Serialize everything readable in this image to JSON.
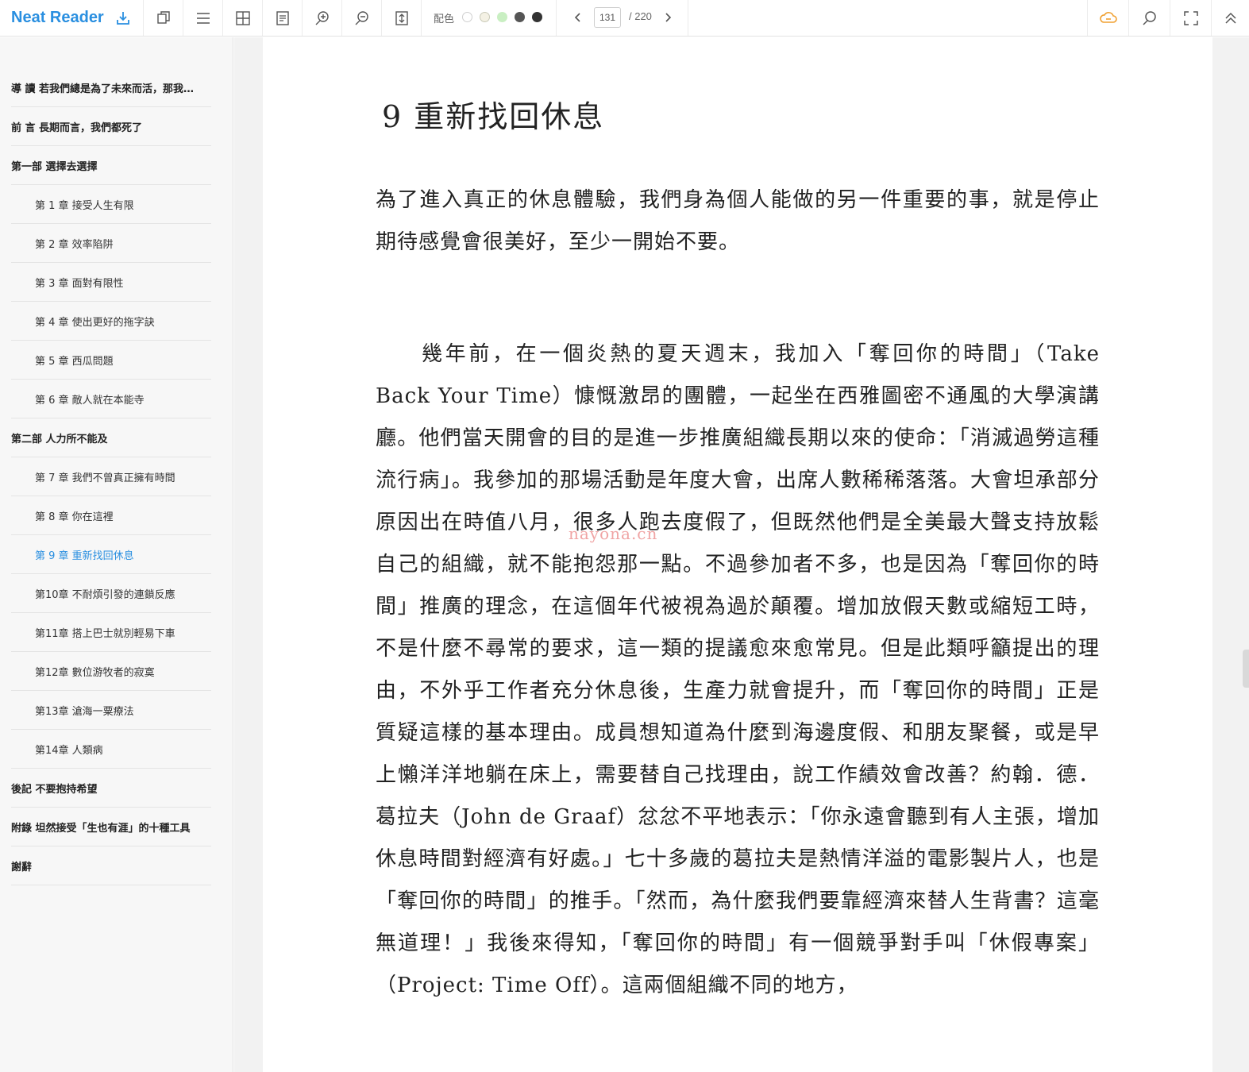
{
  "app": {
    "brand": "Neat Reader",
    "color_scheme_label": "配色",
    "swatches": [
      "#ffffff",
      "#f4f1e4",
      "#c9efc2",
      "#555555",
      "#333333"
    ],
    "page_current": "131",
    "page_total": "/ 220",
    "accent": "#2a8fe0"
  },
  "toolbar_icons": [
    "import-icon",
    "copy-icon",
    "menu-icon",
    "grid-icon",
    "notes-icon",
    "zoom-in-icon",
    "zoom-out-icon",
    "fit-height-icon",
    "cloud-icon",
    "search-icon",
    "fullscreen-icon",
    "collapse-up-icon"
  ],
  "toc": [
    {
      "label": "導 讀 若我們總是為了未來而活，那我…",
      "kind": "part"
    },
    {
      "label": "前 言 長期而言，我們都死了",
      "kind": "part"
    },
    {
      "label": "第一部 選擇去選擇",
      "kind": "part"
    },
    {
      "label": "第 1 章 接受人生有限",
      "kind": "chapter"
    },
    {
      "label": "第 2 章 效率陷阱",
      "kind": "chapter"
    },
    {
      "label": "第 3 章 面對有限性",
      "kind": "chapter"
    },
    {
      "label": "第 4 章 使出更好的拖字訣",
      "kind": "chapter"
    },
    {
      "label": "第 5 章 西瓜問題",
      "kind": "chapter"
    },
    {
      "label": "第 6 章 敵人就在本能寺",
      "kind": "chapter"
    },
    {
      "label": "第二部 人力所不能及",
      "kind": "part"
    },
    {
      "label": "第 7 章 我們不曾真正擁有時間",
      "kind": "chapter"
    },
    {
      "label": "第 8 章 你在這裡",
      "kind": "chapter"
    },
    {
      "label": "第 9 章 重新找回休息",
      "kind": "chapter",
      "active": true
    },
    {
      "label": "第10章 不耐煩引發的連鎖反應",
      "kind": "chapter"
    },
    {
      "label": "第11章 搭上巴士就別輕易下車",
      "kind": "chapter"
    },
    {
      "label": "第12章 數位游牧者的寂寞",
      "kind": "chapter"
    },
    {
      "label": "第13章 滄海一粟療法",
      "kind": "chapter"
    },
    {
      "label": "第14章 人類病",
      "kind": "chapter"
    },
    {
      "label": "後記 不要抱持希望",
      "kind": "part"
    },
    {
      "label": "附錄 坦然接受「生也有涯」的十種工具",
      "kind": "part"
    },
    {
      "label": "謝辭",
      "kind": "part"
    }
  ],
  "book": {
    "chapter_title": "9  重新找回休息",
    "paragraph_1": "為了進入真正的休息體驗，我們身為個人能做的另一件重要的事，就是停止期待感覺會很美好，至少一開始不要。",
    "paragraph_2": "幾年前，在一個炎熱的夏天週末，我加入「奪回你的時間」（Take Back Your Time）慷慨激昂的團體，一起坐在西雅圖密不通風的大學演講廳。他們當天開會的目的是進一步推廣組織長期以來的使命：「消滅過勞這種流行病」。我參加的那場活動是年度大會，出席人數稀稀落落。大會坦承部分原因出在時值八月，很多人跑去度假了，但既然他們是全美最大聲支持放鬆自己的組織，就不能抱怨那一點。不過參加者不多，也是因為「奪回你的時間」推廣的理念，在這個年代被視為過於顛覆。增加放假天數或縮短工時，不是什麼不尋常的要求，這一類的提議愈來愈常見。但是此類呼籲提出的理由，不外乎工作者充分休息後，生產力就會提升，而「奪回你的時間」正是質疑這樣的基本理由。成員想知道為什麼到海邊度假、和朋友聚餐，或是早上懶洋洋地躺在床上，需要替自己找理由，說工作績效會改善？約翰．德．葛拉夫（John de Graaf）忿忿不平地表示：「你永遠會聽到有人主張，增加休息時間對經濟有好處。」七十多歲的葛拉夫是熱情洋溢的電影製片人，也是「奪回你的時間」的推手。「然而，為什麼我們要靠經濟來替人生背書？這毫無道理！」我後來得知，「奪回你的時間」有一個競爭對手叫「休假專案」（Project: Time Off）。這兩個組織不同的地方，",
    "watermark": "nayona.cn"
  }
}
